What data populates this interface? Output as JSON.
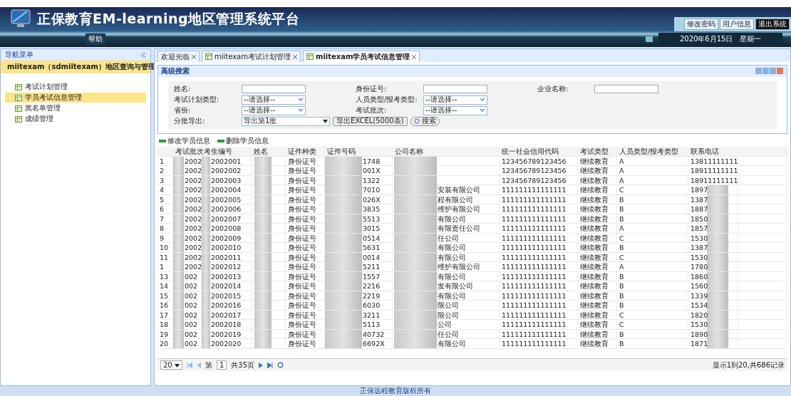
{
  "header": {
    "title": "正保教育EM-learning地区管理系统平台",
    "links": [
      "修改密码",
      "用户信息",
      "退出系统"
    ],
    "help": "帮助",
    "date": "2020年6月15日   星期一"
  },
  "sidebar": {
    "title": "导航菜单",
    "section": "miitexam（sdmiitexam）地区查询与管理",
    "items": [
      {
        "label": "考试计划管理",
        "selected": false
      },
      {
        "label": "学员考试信息管理",
        "selected": true
      },
      {
        "label": "黑名单管理",
        "selected": false
      },
      {
        "label": "成绩管理",
        "selected": false
      }
    ]
  },
  "tabs": [
    {
      "label": "欢迎光临",
      "selected": false,
      "icon": false
    },
    {
      "label": "miitexam考试计划管理",
      "selected": false,
      "icon": true
    },
    {
      "label": "miitexam学员考试信息管理",
      "selected": true,
      "icon": true
    }
  ],
  "search": {
    "title": "高级搜索",
    "fields": [
      {
        "label": "姓名:",
        "kind": "text"
      },
      {
        "label": "身份证号:",
        "kind": "text"
      },
      {
        "label": "企业名称:",
        "kind": "text"
      },
      {
        "label": "考试计划类型:",
        "kind": "select",
        "value": "--请选择--"
      },
      {
        "label": "人员类型/报考类型:",
        "kind": "select",
        "value": "--请选择--"
      },
      {
        "label": "省份:",
        "kind": "select",
        "value": "--请选择--"
      },
      {
        "label": "考试批次:",
        "kind": "select",
        "value": "--请选择--"
      }
    ],
    "export_label": "分批导出:",
    "export_value": "导出第1批",
    "export_button": "导出EXCEL(5000条)",
    "search_button": "搜索"
  },
  "toolbar": [
    "修改学员信息",
    "删除学员信息"
  ],
  "table": {
    "columns": [
      "考试批次",
      "考生编号",
      "姓名",
      "证件种类",
      "证件号码",
      "公司名称",
      "统一社会信用代码",
      "考试类型",
      "人员类型/报考类型",
      "联系电话"
    ],
    "rows": [
      {
        "number": "1",
        "masked": false,
        "cells": [
          "2002",
          "2002001",
          "",
          "身份证号",
          "1748",
          "",
          "123456789123456",
          "继续教育",
          "A",
          "13811111111"
        ]
      },
      {
        "number": "2",
        "masked": false,
        "cells": [
          "2002",
          "2002002",
          "",
          "身份证号",
          "001X",
          "",
          "123456789123456",
          "继续教育",
          "A",
          "18911111111"
        ]
      },
      {
        "number": "3",
        "masked": false,
        "cells": [
          "2002",
          "2002003",
          "",
          "身份证号",
          "1322",
          "",
          "123456789123456",
          "继续教育",
          "A",
          "18911111111"
        ]
      },
      {
        "number": "4",
        "masked": true,
        "cells": [
          "2002",
          "2002004",
          "",
          "身份证号",
          "7010",
          "安装有限公司",
          "111111111111111",
          "继续教育",
          "C",
          "1897"
        ]
      },
      {
        "number": "5",
        "masked": true,
        "cells": [
          "2002",
          "2002005",
          "",
          "身份证号",
          "026X",
          "程有限公司",
          "111111111111111",
          "继续教育",
          "B",
          "1387"
        ]
      },
      {
        "number": "6",
        "masked": true,
        "cells": [
          "2002",
          "2002006",
          "",
          "身份证号",
          "3835",
          "维护有限公司",
          "111111111111111",
          "继续教育",
          "B",
          "1887"
        ]
      },
      {
        "number": "7",
        "masked": true,
        "cells": [
          "2002",
          "2002007",
          "",
          "身份证号",
          "5513",
          "有限公司",
          "111111111111111",
          "继续教育",
          "B",
          "1850"
        ]
      },
      {
        "number": "8",
        "masked": true,
        "cells": [
          "2002",
          "2002008",
          "",
          "身份证号",
          "3015",
          "有限责任公司",
          "111111111111111",
          "继续教育",
          "A",
          "1857"
        ]
      },
      {
        "number": "9",
        "masked": true,
        "cells": [
          "2002",
          "2002009",
          "",
          "身份证号",
          "0514",
          "任公司",
          "111111111111111",
          "继续教育",
          "C",
          "1530"
        ]
      },
      {
        "number": "10",
        "masked": true,
        "cells": [
          "2002",
          "2002010",
          "",
          "身份证号",
          "5631",
          "有限公司",
          "111111111111111",
          "继续教育",
          "B",
          "1387"
        ]
      },
      {
        "number": "11",
        "masked": true,
        "cells": [
          "2002",
          "2002011",
          "",
          "身份证号",
          "0014",
          "有限公司",
          "111111111111111",
          "继续教育",
          "C",
          "1530"
        ]
      },
      {
        "number": "1",
        "masked": true,
        "cells": [
          "2002",
          "2002012",
          "",
          "身份证号",
          "5211",
          "维护有限公司",
          "111111111111111",
          "继续教育",
          "A",
          "1780"
        ]
      },
      {
        "number": "13",
        "masked": true,
        "cells": [
          "002",
          "2002013",
          "",
          "身份证号",
          "1557",
          "有限公司",
          "111111111111111",
          "继续教育",
          "B",
          "1860"
        ]
      },
      {
        "number": "14",
        "masked": true,
        "cells": [
          "002",
          "2002014",
          "",
          "身份证号",
          "2216",
          "发有限公司",
          "111111111111111",
          "继续教育",
          "B",
          "1560"
        ]
      },
      {
        "number": "15",
        "masked": true,
        "cells": [
          "002",
          "2002015",
          "",
          "身份证号",
          "2219",
          "有限公司",
          "111111111111111",
          "继续教育",
          "B",
          "1339"
        ]
      },
      {
        "number": "16",
        "masked": true,
        "cells": [
          "002",
          "2002016",
          "",
          "身份证号",
          "6030",
          "限公司",
          "111111111111111",
          "继续教育",
          "B",
          "1534"
        ]
      },
      {
        "number": "17",
        "masked": true,
        "cells": [
          "002",
          "2002017",
          "",
          "身份证号",
          "3211",
          "限公司",
          "111111111111111",
          "继续教育",
          "C",
          "1820"
        ]
      },
      {
        "number": "18",
        "masked": true,
        "cells": [
          "002",
          "2002018",
          "",
          "身份证号",
          "5113",
          "公司",
          "111111111111111",
          "继续教育",
          "C",
          "1530"
        ]
      },
      {
        "number": "19",
        "masked": true,
        "cells": [
          "002",
          "2002019",
          "",
          "身份证号",
          "40732",
          "任公司",
          "111111111111111",
          "继续教育",
          "B",
          "1890"
        ]
      },
      {
        "number": "20",
        "masked": true,
        "cells": [
          "002",
          "2002020",
          "",
          "身份证号",
          "6692X",
          "有限公司",
          "111111111111111",
          "继续教育",
          "B",
          "1871"
        ]
      }
    ]
  },
  "pager": {
    "page_size": "20",
    "page_prefix": "第",
    "page": "1",
    "pages": "共35页",
    "summary": "显示1到20,共686记录"
  },
  "footer": "正保远程教育版权所有"
}
